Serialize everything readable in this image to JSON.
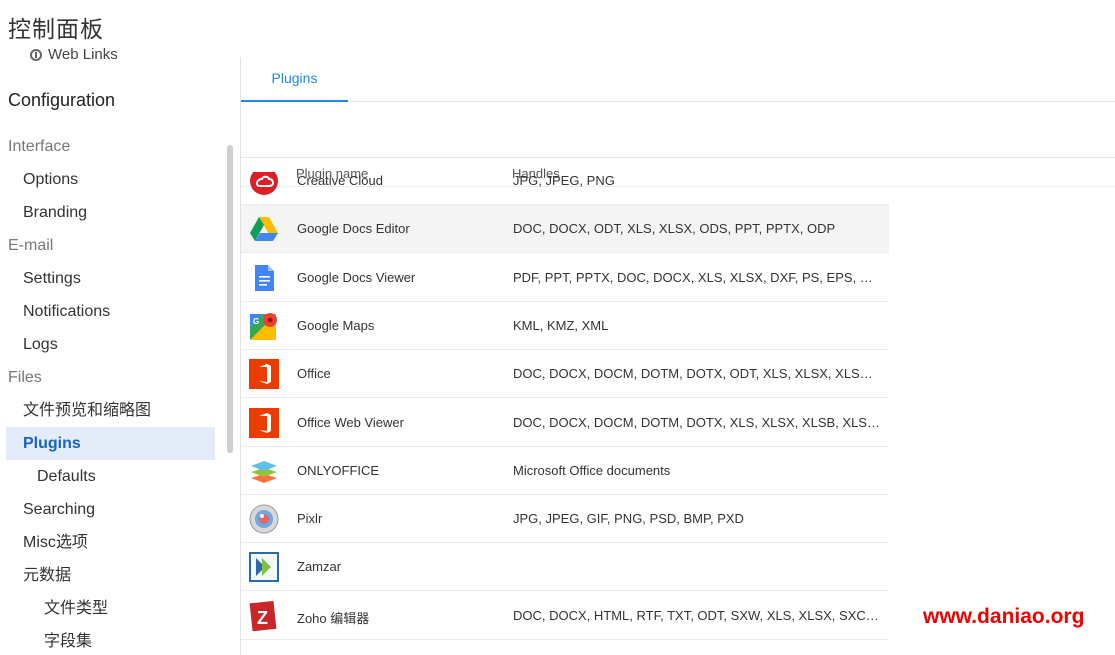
{
  "page_title": "控制面板",
  "sidebar": {
    "weblinks_label": "Web Links",
    "config_title": "Configuration",
    "items": [
      {
        "label": "Interface",
        "level": "section"
      },
      {
        "label": "Options",
        "level": "l1"
      },
      {
        "label": "Branding",
        "level": "l1"
      },
      {
        "label": "E-mail",
        "level": "section"
      },
      {
        "label": "Settings",
        "level": "l1"
      },
      {
        "label": "Notifications",
        "level": "l1"
      },
      {
        "label": "Logs",
        "level": "l1"
      },
      {
        "label": "Files",
        "level": "section"
      },
      {
        "label": "文件预览和缩略图",
        "level": "l1"
      },
      {
        "label": "Plugins",
        "level": "l1",
        "active": true
      },
      {
        "label": "Defaults",
        "level": "l2"
      },
      {
        "label": "Searching",
        "level": "l1"
      },
      {
        "label": "Misc选项",
        "level": "l1"
      },
      {
        "label": "元数据",
        "level": "l1"
      },
      {
        "label": "文件类型",
        "level": "l3"
      },
      {
        "label": "字段集",
        "level": "l3"
      }
    ]
  },
  "main": {
    "tab_label": "Plugins",
    "columns": {
      "name": "Plugin name",
      "handles": "Handles"
    },
    "plugins": [
      {
        "name": "Creative Cloud",
        "handles": "JPG, JPEG, PNG",
        "icon": "creative-cloud-icon"
      },
      {
        "name": "Google Docs Editor",
        "handles": "DOC, DOCX, ODT, XLS, XLSX, ODS, PPT, PPTX, ODP",
        "icon": "google-drive-icon"
      },
      {
        "name": "Google Docs Viewer",
        "handles": "PDF, PPT, PPTX, DOC, DOCX, XLS, XLSX, DXF, PS, EPS, XPS, P...",
        "icon": "google-docs-icon"
      },
      {
        "name": "Google Maps",
        "handles": "KML, KMZ, XML",
        "icon": "google-maps-icon"
      },
      {
        "name": "Office",
        "handles": "DOC, DOCX, DOCM, DOTM, DOTX, ODT, XLS, XLSX, XLSB, XLS,...",
        "icon": "office-icon"
      },
      {
        "name": "Office Web Viewer",
        "handles": "DOC, DOCX, DOCM, DOTM, DOTX, XLS, XLSX, XLSB, XLS, XLS...",
        "icon": "office-web-viewer-icon"
      },
      {
        "name": "ONLYOFFICE",
        "handles": "Microsoft Office documents",
        "icon": "onlyoffice-icon"
      },
      {
        "name": "Pixlr",
        "handles": "JPG, JPEG, GIF, PNG, PSD, BMP, PXD",
        "icon": "pixlr-icon"
      },
      {
        "name": "Zamzar",
        "handles": "",
        "icon": "zamzar-icon"
      },
      {
        "name": "Zoho 编辑器",
        "handles": "DOC, DOCX, HTML, RTF, TXT, ODT, SXW, XLS, XLSX, SXC, CSV,...",
        "icon": "zoho-icon"
      }
    ]
  },
  "watermark": "www.daniao.org",
  "colors": {
    "accent": "#1e88e5",
    "active_bg": "#e3ecf8",
    "watermark": "#ee0000"
  }
}
